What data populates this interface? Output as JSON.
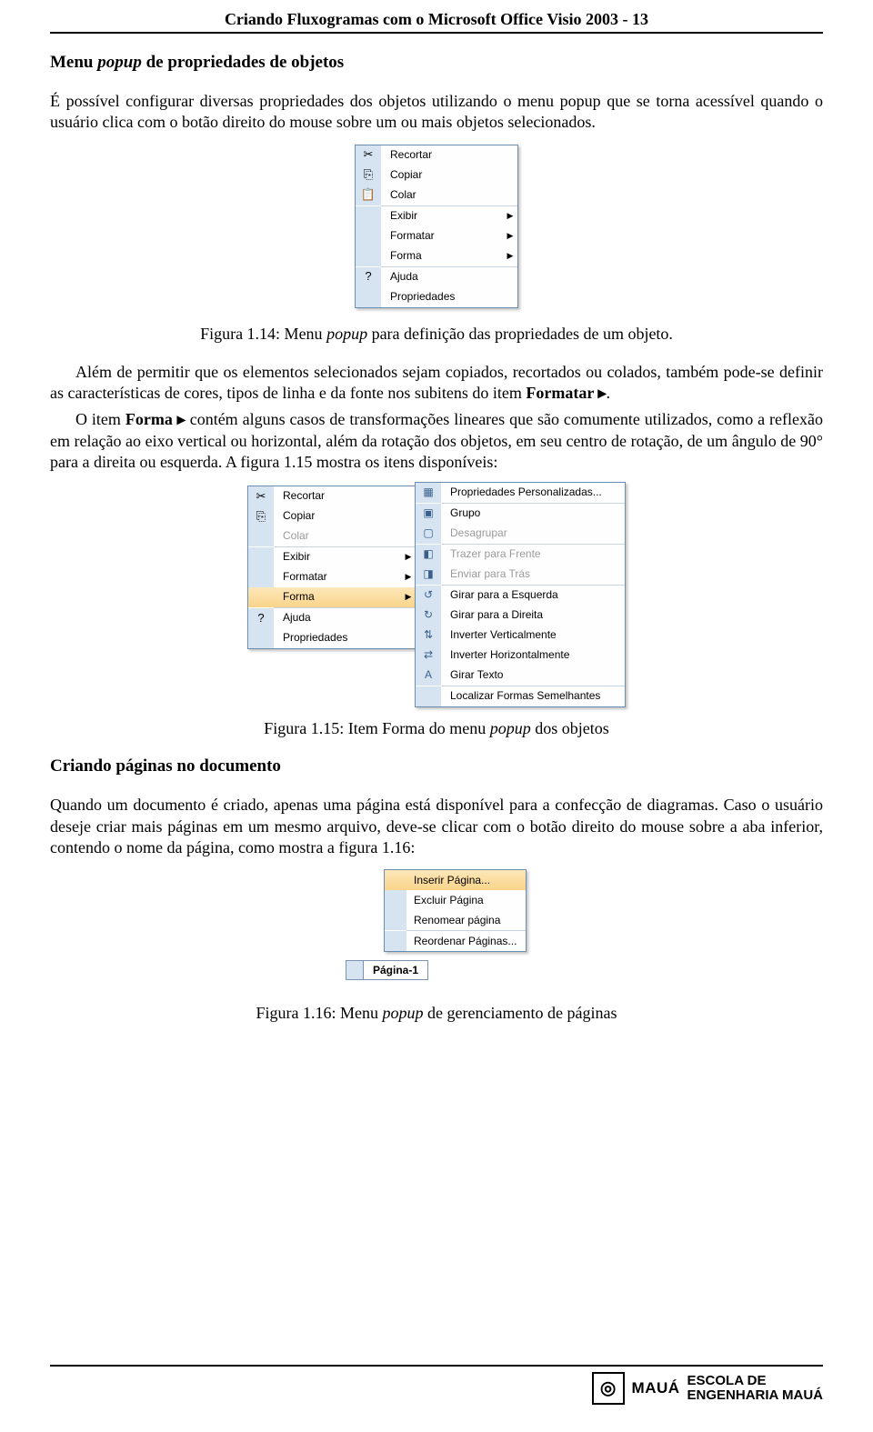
{
  "header": {
    "title": "Criando Fluxogramas com o Microsoft Office Visio 2003 - 13"
  },
  "section1": {
    "heading_prefix": "Menu ",
    "heading_ital": "popup",
    "heading_suffix": " de propriedades de objetos",
    "para": "É possível configurar diversas propriedades dos objetos utilizando o menu popup que se torna acessível quando o usuário clica com o botão direito do mouse sobre um ou mais objetos selecionados."
  },
  "fig114": {
    "caption_prefix": "Figura 1.14: Menu ",
    "caption_ital": "popup",
    "caption_suffix": " para definição das propriedades de um objeto.",
    "items": [
      {
        "label": "Recortar",
        "icon": "✂",
        "iconName": "cut-icon"
      },
      {
        "label": "Copiar",
        "icon": "⎘",
        "iconName": "copy-icon"
      },
      {
        "label": "Colar",
        "icon": "📋",
        "iconName": "paste-icon"
      },
      {
        "sep": true
      },
      {
        "label": "Exibir",
        "submenu": true
      },
      {
        "label": "Formatar",
        "submenu": true
      },
      {
        "label": "Forma",
        "submenu": true
      },
      {
        "sep": true
      },
      {
        "label": "Ajuda",
        "icon": "?",
        "iconName": "help-icon"
      },
      {
        "label": "Propriedades"
      }
    ]
  },
  "section2": {
    "para1_pre": "Além de permitir que os elementos selecionados sejam copiados, recortados ou colados, também pode-se definir as características de cores, tipos de linha e da fonte nos subitens do item ",
    "para1_bold1": "Formatar ▸",
    "para1_post": ".",
    "para2_pre": "O item ",
    "para2_bold": "Forma ▸",
    "para2_mid": " contém alguns casos de transformações lineares que são comumente utilizados, como a reflexão em relação ao eixo vertical ou horizontal, além da rotação dos objetos, em seu centro de rotação, de um ângulo de 90° para a direita ou esquerda. A figura 1.15 mostra os itens disponíveis:"
  },
  "fig115": {
    "caption_prefix": "Figura 1.15: Item Forma do menu ",
    "caption_ital": "popup",
    "caption_suffix": " dos objetos",
    "main": [
      {
        "label": "Recortar",
        "icon": "✂",
        "iconName": "cut-icon"
      },
      {
        "label": "Copiar",
        "icon": "⎘",
        "iconName": "copy-icon"
      },
      {
        "label": "Colar",
        "icon": "",
        "disabled": true
      },
      {
        "sep": true
      },
      {
        "label": "Exibir",
        "submenu": true
      },
      {
        "label": "Formatar",
        "submenu": true
      },
      {
        "label": "Forma",
        "submenu": true,
        "hot": true
      },
      {
        "sep": true
      },
      {
        "label": "Ajuda",
        "icon": "?",
        "iconName": "help-icon"
      },
      {
        "label": "Propriedades"
      }
    ],
    "sub": [
      {
        "label": "Propriedades Personalizadas...",
        "icon": "▦"
      },
      {
        "sep": true
      },
      {
        "label": "Grupo",
        "icon": "▣"
      },
      {
        "label": "Desagrupar",
        "icon": "▢",
        "disabled": true
      },
      {
        "sep": true
      },
      {
        "label": "Trazer para Frente",
        "icon": "◧",
        "disabled": true
      },
      {
        "label": "Enviar para Trás",
        "icon": "◨",
        "disabled": true
      },
      {
        "sep": true
      },
      {
        "label": "Girar para a Esquerda",
        "icon": "↺"
      },
      {
        "label": "Girar para a Direita",
        "icon": "↻"
      },
      {
        "label": "Inverter Verticalmente",
        "icon": "⇅"
      },
      {
        "label": "Inverter Horizontalmente",
        "icon": "⇄"
      },
      {
        "label": "Girar Texto",
        "icon": "A"
      },
      {
        "sep": true
      },
      {
        "label": "Localizar Formas Semelhantes"
      }
    ]
  },
  "section3": {
    "heading": "Criando páginas no documento",
    "para": "Quando um documento é criado, apenas uma página está disponível para a confecção de diagramas. Caso o usuário deseje criar mais páginas em um mesmo arquivo, deve-se clicar com o botão direito do mouse sobre a aba inferior, contendo o nome da página, como mostra a figura 1.16:"
  },
  "fig116": {
    "caption_prefix": "Figura 1.16: Menu ",
    "caption_ital": "popup",
    "caption_suffix": " de gerenciamento de páginas",
    "items": [
      {
        "label": "Inserir Página...",
        "hot": true
      },
      {
        "label": "Excluir Página"
      },
      {
        "label": "Renomear página"
      },
      {
        "sep": true
      },
      {
        "label": "Reordenar Páginas..."
      }
    ],
    "tab_label": "Página-1"
  },
  "footer": {
    "maua": "MAUÁ",
    "line1": "ESCOLA DE",
    "line2": "ENGENHARIA MAUÁ"
  }
}
